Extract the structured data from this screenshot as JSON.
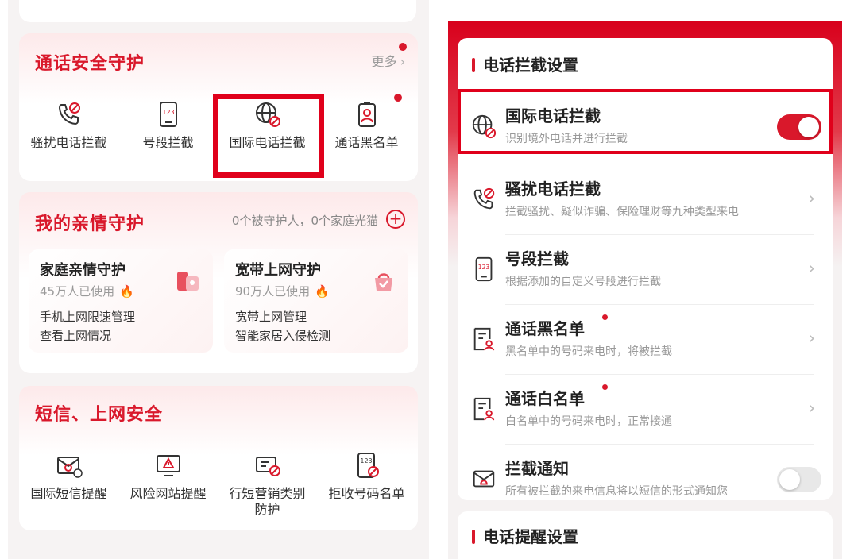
{
  "left": {
    "call_safety": {
      "title": "通话安全守护",
      "more": "更多",
      "items": [
        {
          "label": "骚扰电话拦截",
          "icon": "phone-block-icon"
        },
        {
          "label": "号段拦截",
          "icon": "number-segment-icon"
        },
        {
          "label": "国际电话拦截",
          "icon": "globe-block-icon"
        },
        {
          "label": "通话黑名单",
          "icon": "contact-badge-icon"
        }
      ]
    },
    "family": {
      "title": "我的亲情守护",
      "guarded_count": "0个被守护人，0个家庭光猫",
      "cards": [
        {
          "title": "家庭亲情守护",
          "users": "45万人已使用",
          "line1": "手机上网限速管理",
          "line2": "查看上网情况",
          "icon": "family-icon"
        },
        {
          "title": "宽带上网守护",
          "users": "90万人已使用",
          "line1": "宽带上网管理",
          "line2": "智能家居入侵检测",
          "icon": "broadband-icon"
        }
      ]
    },
    "sms_web": {
      "title": "短信、上网安全",
      "items": [
        {
          "label": "国际短信提醒",
          "icon": "intl-sms-icon"
        },
        {
          "label": "风险网站提醒",
          "icon": "risk-site-icon"
        },
        {
          "label": "行短营销类别防护",
          "icon": "marketing-sms-icon"
        },
        {
          "label": "拒收号码名单",
          "icon": "reject-number-icon"
        }
      ]
    }
  },
  "right": {
    "section_title": "电话拦截设置",
    "rows": [
      {
        "title": "国际电话拦截",
        "subtitle": "识别境外电话并进行拦截",
        "control": "toggle",
        "on": true,
        "icon": "globe-block-icon"
      },
      {
        "title": "骚扰电话拦截",
        "subtitle": "拦截骚扰、疑似诈骗、保险理财等九种类型来电",
        "control": "arrow",
        "icon": "phone-block-icon"
      },
      {
        "title": "号段拦截",
        "subtitle": "根据添加的自定义号段进行拦截",
        "control": "arrow",
        "icon": "number-segment-icon"
      },
      {
        "title": "通话黑名单",
        "subtitle": "黑名单中的号码来电时，将被拦截",
        "control": "arrow",
        "icon": "list-person-icon",
        "dot": true
      },
      {
        "title": "通话白名单",
        "subtitle": "白名单中的号码来电时，正常接通",
        "control": "arrow",
        "icon": "list-person-icon",
        "dot": true
      },
      {
        "title": "拦截通知",
        "subtitle": "所有被拦截的来电信息将以短信的形式通知您",
        "control": "toggle",
        "on": false,
        "icon": "envelope-bell-icon"
      }
    ],
    "section2_title": "电话提醒设置"
  },
  "colors": {
    "accent": "#d9182b",
    "highlight": "#e0001b"
  }
}
